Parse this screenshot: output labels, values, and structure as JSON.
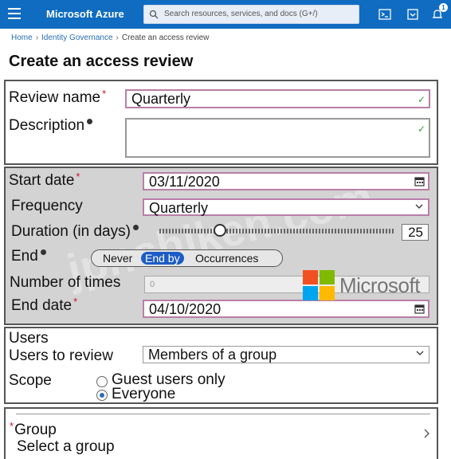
{
  "topbar": {
    "brand": "Microsoft Azure",
    "search_placeholder": "Search resources, services, and docs (G+/)",
    "notification_count": "1",
    "color": "#0f6cc1"
  },
  "breadcrumb": {
    "items": [
      "Home",
      "Identity Governance",
      "Create an access review"
    ]
  },
  "page": {
    "title": "Create an access review"
  },
  "basics": {
    "review_name_label": "Review name",
    "review_name_value": "Quarterly",
    "description_label": "Description",
    "description_value": ""
  },
  "schedule": {
    "start_date_label": "Start date",
    "start_date_value": "03/11/2020",
    "frequency_label": "Frequency",
    "frequency_value": "Quarterly",
    "duration_label": "Duration (in days)",
    "duration_value": "25",
    "end_label": "End",
    "end_options": [
      "Never",
      "End by",
      "Occurrences"
    ],
    "end_selected": "End by",
    "number_of_times_label": "Number of times",
    "number_of_times_value": "0",
    "end_date_label": "End date",
    "end_date_value": "04/10/2020"
  },
  "users": {
    "section_label": "Users",
    "users_to_review_label": "Users to review",
    "users_to_review_value": "Members of a group",
    "scope_label": "Scope",
    "scope_options": [
      "Guest users only",
      "Everyone"
    ],
    "scope_selected": "Everyone"
  },
  "group": {
    "label": "Group",
    "placeholder": "Select a group"
  },
  "overlay": {
    "logo_text": "Microsoft",
    "watermark": "jpnshiken.com"
  }
}
